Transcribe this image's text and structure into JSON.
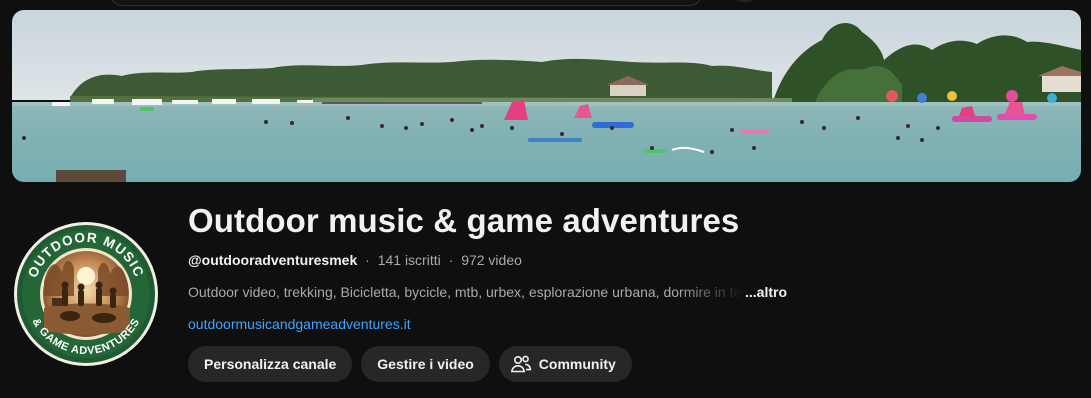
{
  "channel": {
    "title": "Outdoor music & game adventures",
    "handle": "@outdooradventuresmek",
    "subscribers": "141 iscritti",
    "videos": "972 video",
    "separator": "·",
    "description": "Outdoor video, trekking, Bicicletta, bycicle, mtb, urbex, esplorazione urbana, dormire in tenda",
    "more_label": "...altro",
    "link": "outdoormusicandgameadventures.it"
  },
  "avatar": {
    "top_text": "OUTDOOR MUSIC",
    "bottom_text": "& GAME ADVENTURES"
  },
  "buttons": {
    "customize": "Personalizza canale",
    "manage": "Gestire i video",
    "community": "Community"
  },
  "icons": {
    "community": "people-icon"
  },
  "colors": {
    "background": "#0f0f0f",
    "link": "#3ea6ff",
    "button_bg": "#272727",
    "avatar_ring": "#1f5a32"
  }
}
